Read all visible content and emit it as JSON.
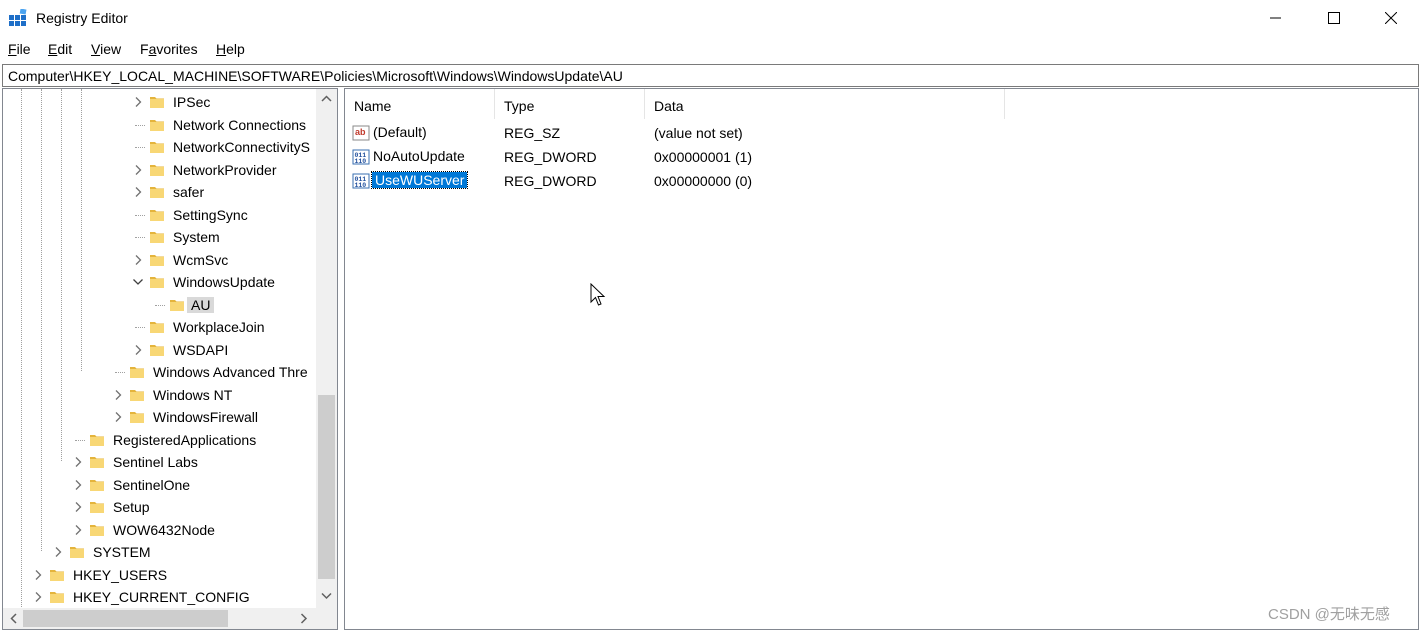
{
  "window": {
    "title": "Registry Editor",
    "min_label": "—",
    "max_label": "☐",
    "close_label": "✕"
  },
  "menu": [
    {
      "key": "F",
      "rest": "ile"
    },
    {
      "key": "E",
      "rest": "dit"
    },
    {
      "key": "V",
      "rest": "iew"
    },
    {
      "key": "",
      "pre": "F",
      "key2": "a",
      "rest": "vorites"
    },
    {
      "key": "H",
      "rest": "elp"
    }
  ],
  "address": "Computer\\HKEY_LOCAL_MACHINE\\SOFTWARE\\Policies\\Microsoft\\Windows\\WindowsUpdate\\AU",
  "tree": [
    {
      "label": "IPSec",
      "level": 4,
      "expander": "collapsed"
    },
    {
      "label": "Network Connections",
      "level": 4,
      "expander": "none"
    },
    {
      "label": "NetworkConnectivityS",
      "level": 4,
      "expander": "none"
    },
    {
      "label": "NetworkProvider",
      "level": 4,
      "expander": "collapsed"
    },
    {
      "label": "safer",
      "level": 4,
      "expander": "collapsed"
    },
    {
      "label": "SettingSync",
      "level": 4,
      "expander": "none"
    },
    {
      "label": "System",
      "level": 4,
      "expander": "none"
    },
    {
      "label": "WcmSvc",
      "level": 4,
      "expander": "collapsed"
    },
    {
      "label": "WindowsUpdate",
      "level": 4,
      "expander": "expanded"
    },
    {
      "label": "AU",
      "level": 5,
      "expander": "none",
      "selected": true
    },
    {
      "label": "WorkplaceJoin",
      "level": 4,
      "expander": "none"
    },
    {
      "label": "WSDAPI",
      "level": 4,
      "expander": "collapsed"
    },
    {
      "label": "Windows Advanced Thre",
      "level": 3,
      "expander": "none"
    },
    {
      "label": "Windows NT",
      "level": 3,
      "expander": "collapsed"
    },
    {
      "label": "WindowsFirewall",
      "level": 3,
      "expander": "collapsed"
    },
    {
      "label": "RegisteredApplications",
      "level": 2,
      "expander": "none"
    },
    {
      "label": "Sentinel Labs",
      "level": 2,
      "expander": "collapsed"
    },
    {
      "label": "SentinelOne",
      "level": 2,
      "expander": "collapsed"
    },
    {
      "label": "Setup",
      "level": 2,
      "expander": "collapsed"
    },
    {
      "label": "WOW6432Node",
      "level": 2,
      "expander": "collapsed"
    },
    {
      "label": "SYSTEM",
      "level": 1,
      "expander": "collapsed"
    },
    {
      "label": "HKEY_USERS",
      "level": 0,
      "expander": "collapsed"
    },
    {
      "label": "HKEY_CURRENT_CONFIG",
      "level": 0,
      "expander": "collapsed"
    }
  ],
  "list": {
    "columns": [
      "Name",
      "Type",
      "Data"
    ],
    "rows": [
      {
        "icon": "string-value-icon",
        "name": "(Default)",
        "type": "REG_SZ",
        "data": "(value not set)"
      },
      {
        "icon": "binary-value-icon",
        "name": "NoAutoUpdate",
        "type": "REG_DWORD",
        "data": "0x00000001 (1)"
      },
      {
        "icon": "binary-value-icon",
        "name": "UseWUServer",
        "type": "REG_DWORD",
        "data": "0x00000000 (0)",
        "selected": true
      }
    ]
  },
  "watermark": "CSDN @无味无感",
  "colors": {
    "selection": "#0078d7",
    "folder": "#f8d775",
    "folder_dark": "#e4b43c"
  }
}
